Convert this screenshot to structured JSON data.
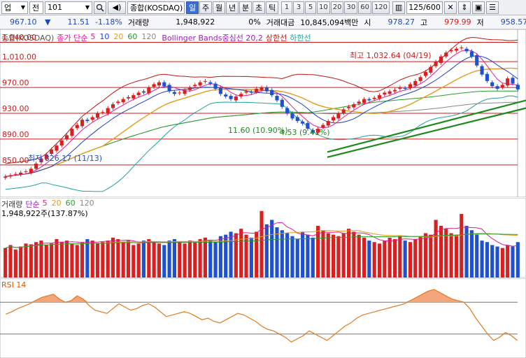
{
  "toolbar": {
    "market": "업",
    "period_label": "전",
    "code": "101",
    "name": "종합(KOSDAQ)",
    "period_buttons": [
      "일",
      "주",
      "월",
      "년",
      "분",
      "초",
      "틱"
    ],
    "active_period": "일",
    "intervals": [
      "1",
      "3",
      "5",
      "10",
      "20",
      "30",
      "60",
      "120"
    ],
    "page_count": "125/600"
  },
  "info": {
    "price": "967.10",
    "change": "11.51",
    "change_pct": "-1.18%",
    "volume_label": "거래량",
    "volume": "1,948,922",
    "volume_pct": "0%",
    "amount_label": "거래대금",
    "amount": "10,845,094백만",
    "open_label": "시",
    "open": "978.27",
    "high_label": "고",
    "high": "979.99",
    "low_label": "저",
    "low": "958.57"
  },
  "price_legend": {
    "name": "종합(KOSDAQ)",
    "ma_label": "종가 단순",
    "ma_periods": [
      "5",
      "10",
      "20",
      "60",
      "120"
    ],
    "bb_label": "Bollinger Bands중심선 20,2",
    "upper_label": "상한선",
    "lower_label": "하한선"
  },
  "volume_legend": {
    "name": "거래량",
    "ma_label": "단순",
    "periods": [
      "5",
      "20",
      "60",
      "120"
    ],
    "current": "1,948,922주(137.87%)"
  },
  "rsi_legend": {
    "name": "RSI 14"
  },
  "annotations": {
    "high": "최고 1,032.64 (04/19)",
    "low": "최저 826.17 (11/13)",
    "trend1": "11.60 (10.90%)",
    "trend2": "4.53 (9.41%)"
  },
  "colors": {
    "up": "#d92020",
    "down": "#1e50d0",
    "ma5": "#e01b8e",
    "ma10": "#1e40c8",
    "ma20": "#e39b1c",
    "ma60": "#22a028",
    "ma120": "#888888",
    "bb": "#c01414",
    "trend": "#1b8a1b"
  },
  "chart_data": [
    {
      "type": "candlestick",
      "name": "종합(KOSDAQ)",
      "ylim": [
        800,
        1060
      ],
      "y_ticks": [
        1040,
        1010,
        970,
        930,
        890,
        850
      ],
      "horizontal_lines": [
        1040,
        1010,
        970,
        930,
        890,
        850
      ],
      "close": [
        832,
        834,
        836,
        838,
        840,
        844,
        852,
        860,
        866,
        874,
        880,
        888,
        896,
        906,
        912,
        920,
        918,
        924,
        930,
        932,
        938,
        944,
        948,
        952,
        955,
        958,
        962,
        962,
        970,
        975,
        978,
        972,
        964,
        960,
        962,
        966,
        970,
        974,
        978,
        980,
        976,
        968,
        960,
        956,
        952,
        956,
        960,
        964,
        962,
        968,
        970,
        964,
        958,
        950,
        940,
        930,
        922,
        918,
        914,
        906,
        900,
        906,
        912,
        918,
        924,
        930,
        936,
        940,
        944,
        948,
        952,
        950,
        954,
        958,
        962,
        964,
        966,
        970,
        968,
        975,
        980,
        986,
        994,
        1002,
        1010,
        1018,
        1024,
        1028,
        1030,
        1032,
        1026,
        1018,
        1004,
        990,
        980,
        972,
        968,
        974,
        984,
        976,
        967
      ],
      "annotations": [
        "최고 1,032.64 (04/19)",
        "최저 826.17 (11/13)",
        "11.60 (10.90%)",
        "4.53 (9.41%)"
      ],
      "series": [
        {
          "name": "5"
        },
        {
          "name": "10"
        },
        {
          "name": "20"
        },
        {
          "name": "60"
        },
        {
          "name": "120"
        },
        {
          "name": "상한선"
        },
        {
          "name": "하한선"
        }
      ]
    },
    {
      "type": "bar",
      "name": "거래량",
      "current": "1,948,922",
      "values": [
        40,
        44,
        38,
        42,
        46,
        45,
        48,
        50,
        44,
        46,
        52,
        48,
        50,
        46,
        44,
        48,
        52,
        50,
        46,
        48,
        50,
        54,
        52,
        48,
        50,
        44,
        46,
        50,
        52,
        48,
        46,
        44,
        50,
        52,
        48,
        46,
        50,
        48,
        52,
        54,
        50,
        48,
        56,
        58,
        62,
        60,
        66,
        58,
        54,
        62,
        90,
        72,
        78,
        68,
        64,
        60,
        56,
        52,
        62,
        58,
        54,
        70,
        64,
        60,
        58,
        56,
        60,
        66,
        62,
        58,
        54,
        50,
        48,
        46,
        50,
        54,
        52,
        56,
        50,
        48,
        52,
        56,
        60,
        58,
        78,
        70,
        66,
        60,
        58,
        86,
        70,
        64,
        58,
        50,
        48,
        44,
        42,
        40,
        44,
        42,
        48
      ]
    },
    {
      "type": "line",
      "name": "RSI 14",
      "ylim": [
        0,
        100
      ],
      "levels": [
        70,
        30
      ],
      "values": [
        55,
        58,
        62,
        65,
        68,
        72,
        76,
        78,
        80,
        74,
        70,
        72,
        78,
        74,
        66,
        60,
        58,
        56,
        62,
        68,
        64,
        60,
        62,
        66,
        68,
        64,
        58,
        52,
        54,
        56,
        58,
        56,
        52,
        48,
        50,
        46,
        44,
        48,
        52,
        56,
        54,
        50,
        46,
        40,
        36,
        34,
        30,
        26,
        20,
        24,
        28,
        34,
        30,
        26,
        22,
        28,
        34,
        40,
        44,
        50,
        54,
        56,
        58,
        60,
        62,
        64,
        66,
        68,
        72,
        76,
        80,
        84,
        86,
        82,
        78,
        74,
        72,
        70,
        62,
        50,
        40,
        30,
        22,
        26,
        32,
        28,
        22
      ]
    }
  ]
}
